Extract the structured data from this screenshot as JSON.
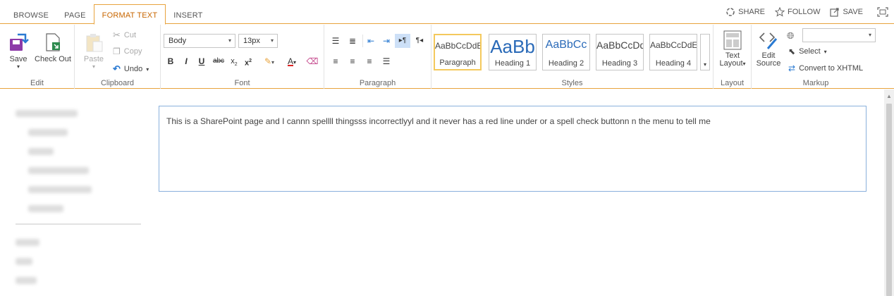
{
  "tabs": [
    "BROWSE",
    "PAGE",
    "FORMAT TEXT",
    "INSERT"
  ],
  "actions": {
    "share": "SHARE",
    "follow": "FOLLOW",
    "save": "SAVE"
  },
  "groups": {
    "edit": {
      "label": "Edit",
      "save": "Save",
      "checkout": "Check Out"
    },
    "clipboard": {
      "label": "Clipboard",
      "paste": "Paste",
      "cut": "Cut",
      "copy": "Copy",
      "undo": "Undo"
    },
    "font": {
      "label": "Font",
      "family": "Body",
      "size": "13px"
    },
    "paragraph": {
      "label": "Paragraph"
    },
    "styles": {
      "label": "Styles",
      "items": [
        {
          "sample": "AaBbCcDdE",
          "name": "Paragraph"
        },
        {
          "sample": "AaBb",
          "name": "Heading 1"
        },
        {
          "sample": "AaBbCc",
          "name": "Heading 2"
        },
        {
          "sample": "AaBbCcDd",
          "name": "Heading 3"
        },
        {
          "sample": "AaBbCcDdE",
          "name": "Heading 4"
        }
      ]
    },
    "layout": {
      "label": "Layout",
      "line1": "Text",
      "line2": "Layout"
    },
    "markup": {
      "label": "Markup",
      "edit_source_1": "Edit",
      "edit_source_2": "Source",
      "select": "Select",
      "convert": "Convert to XHTML"
    }
  },
  "editor": {
    "text": "This is a SharePoint page and I cannn spellll thingsss incorrectlyyl and it never has a red line under or a spell check buttonn n the menu to tell me"
  },
  "colors": {
    "accent": "#e8a33d",
    "active_tab": "#c86600",
    "editor_border": "#8ab0dc"
  }
}
